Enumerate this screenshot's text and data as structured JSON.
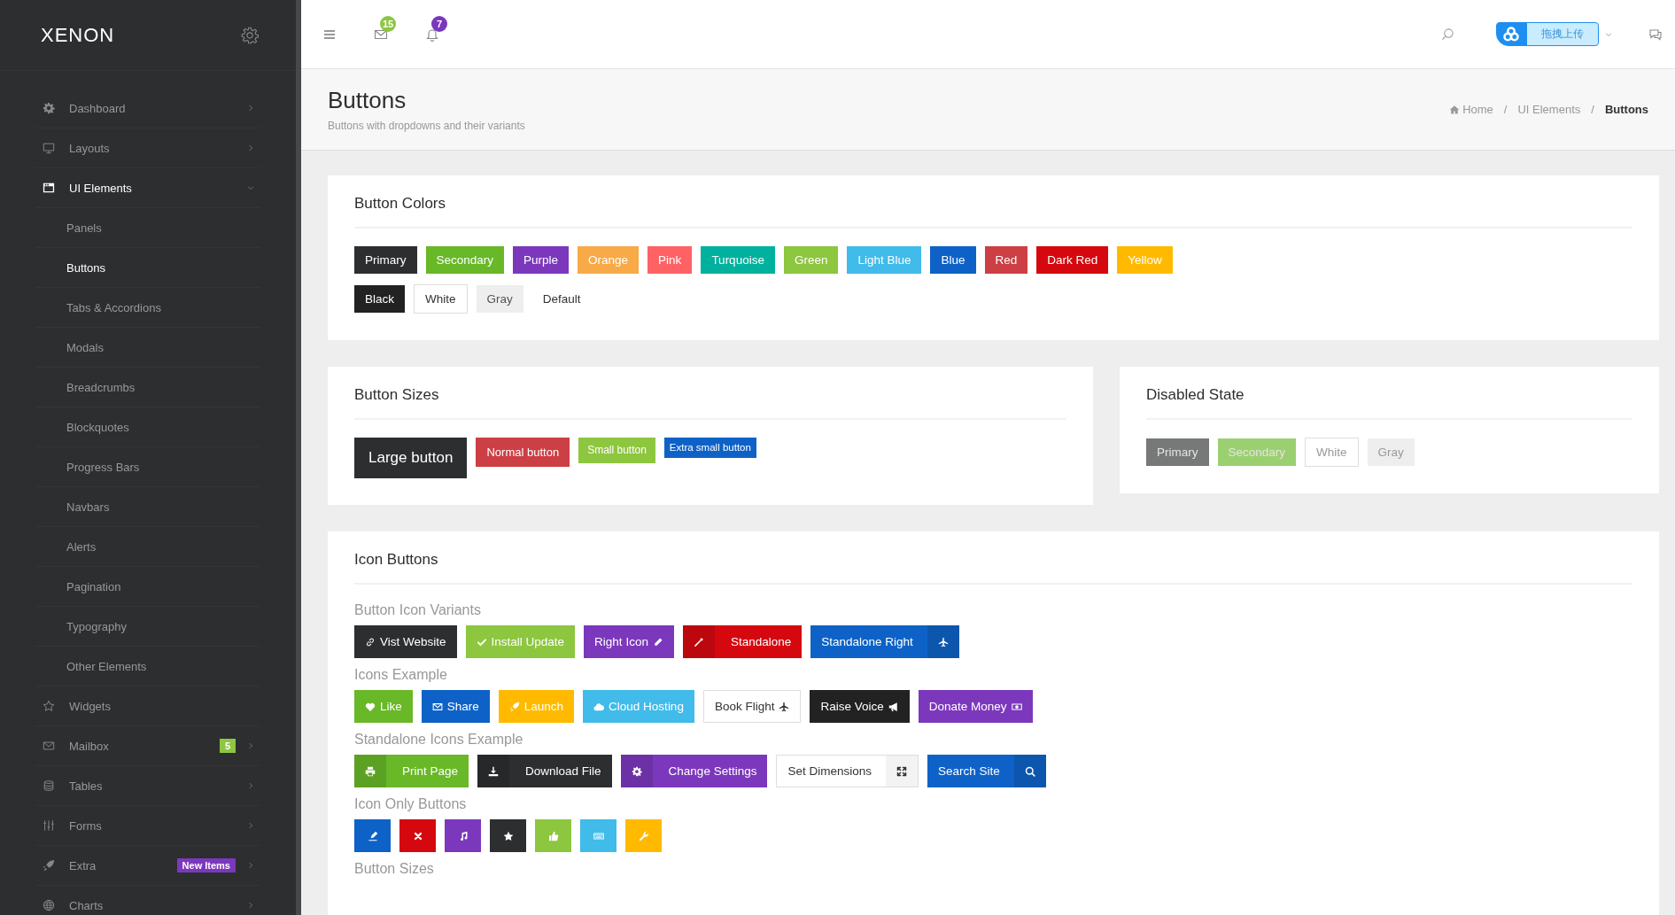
{
  "sidebar": {
    "logo": "XENON",
    "items": [
      {
        "label": "Dashboard",
        "expandable": true,
        "expanded": false,
        "selected": false
      },
      {
        "label": "Layouts",
        "expandable": true,
        "expanded": false,
        "selected": false
      },
      {
        "label": "UI Elements",
        "expandable": true,
        "expanded": true,
        "selected": true,
        "children": [
          {
            "label": "Panels",
            "selected": false
          },
          {
            "label": "Buttons",
            "selected": true
          },
          {
            "label": "Tabs & Accordions",
            "selected": false
          },
          {
            "label": "Modals",
            "selected": false
          },
          {
            "label": "Breadcrumbs",
            "selected": false
          },
          {
            "label": "Blockquotes",
            "selected": false
          },
          {
            "label": "Progress Bars",
            "selected": false
          },
          {
            "label": "Navbars",
            "selected": false
          },
          {
            "label": "Alerts",
            "selected": false
          },
          {
            "label": "Pagination",
            "selected": false
          },
          {
            "label": "Typography",
            "selected": false
          },
          {
            "label": "Other Elements",
            "selected": false
          }
        ]
      },
      {
        "label": "Widgets",
        "expandable": false,
        "selected": false
      },
      {
        "label": "Mailbox",
        "expandable": true,
        "expanded": false,
        "selected": false,
        "badge": "5",
        "color": "#8dc63f"
      },
      {
        "label": "Tables",
        "expandable": true,
        "expanded": false,
        "selected": false
      },
      {
        "label": "Forms",
        "expandable": true,
        "expanded": false,
        "selected": false
      },
      {
        "label": "Extra",
        "expandable": true,
        "expanded": false,
        "selected": false,
        "badge": "New Items",
        "color": "#7c38bc"
      },
      {
        "label": "Charts",
        "expandable": true,
        "expanded": false,
        "selected": false
      }
    ]
  },
  "header": {
    "badges": [
      {
        "count": "15",
        "color": "#8dc63f"
      },
      {
        "count": "7",
        "color": "#7c38bc"
      }
    ],
    "upload_label": "拖拽上传"
  },
  "page_title": {
    "title": "Buttons",
    "subtitle": "Buttons with dropdowns and their variants",
    "separator": "/",
    "breadcrumb": [
      {
        "label": "Home",
        "active": false
      },
      {
        "label": "UI Elements",
        "active": false
      },
      {
        "label": "Buttons",
        "active": true
      }
    ]
  },
  "button_colors": {
    "title": "Button Colors",
    "rows": [
      [
        {
          "label": "Primary",
          "color": "#2c2e2f",
          "kind": "filled"
        },
        {
          "label": "Secondary",
          "color": "#68b828",
          "kind": "filled"
        },
        {
          "label": "Purple",
          "color": "#7c38bc",
          "kind": "filled"
        },
        {
          "label": "Orange",
          "color": "#f7aa47",
          "kind": "filled"
        },
        {
          "label": "Pink",
          "color": "#ff6264",
          "kind": "filled"
        },
        {
          "label": "Turquoise",
          "color": "#00b19d",
          "kind": "filled"
        },
        {
          "label": "Green",
          "color": "#8dc63f",
          "kind": "filled"
        },
        {
          "label": "Light Blue",
          "color": "#40bbea",
          "kind": "filled"
        },
        {
          "label": "Blue",
          "color": "#0e62c7",
          "kind": "filled"
        },
        {
          "label": "Red",
          "color": "#cc3f44",
          "kind": "filled"
        },
        {
          "label": "Dark Red",
          "color": "#d5080f",
          "kind": "filled"
        },
        {
          "label": "Yellow",
          "color": "#ffba00",
          "kind": "filled"
        }
      ],
      [
        {
          "label": "Black",
          "color": "#222222",
          "kind": "filled"
        },
        {
          "label": "White",
          "color": "#ffffff",
          "kind": "outlined"
        },
        {
          "label": "Gray",
          "color": "#eeeeee",
          "kind": "light"
        },
        {
          "label": "Default",
          "color": "#ffffff",
          "kind": "plain"
        }
      ]
    ]
  },
  "button_sizes": {
    "title": "Button Sizes",
    "buttons": [
      {
        "label": "Large button",
        "color": "#2c2e2f",
        "kind": "large"
      },
      {
        "label": "Normal button",
        "color": "#cc3f44",
        "kind": "normal"
      },
      {
        "label": "Small button",
        "color": "#8dc63f",
        "kind": "small"
      },
      {
        "label": "Extra small button",
        "color": "#0e62c7",
        "kind": "xsmall"
      }
    ]
  },
  "disabled_state": {
    "title": "Disabled State",
    "buttons": [
      {
        "label": "Primary",
        "color": "#777878",
        "kind": "filled",
        "disabled": true
      },
      {
        "label": "Secondary",
        "color": "#9bd070",
        "kind": "filled",
        "disabled": true
      },
      {
        "label": "White",
        "color": "#ffffff",
        "kind": "outlined",
        "disabled": true
      },
      {
        "label": "Gray",
        "color": "#eeeeee",
        "kind": "light",
        "disabled": true
      }
    ]
  },
  "icon_buttons": {
    "title": "Icon Buttons",
    "groups": [
      {
        "title": "Button Icon Variants",
        "buttons": [
          {
            "label": "Vist Website",
            "color": "#2c2e2f",
            "kind": "icon-left"
          },
          {
            "label": "Install Update",
            "color": "#8dc63f",
            "kind": "icon-left"
          },
          {
            "label": "Right Icon",
            "color": "#7c38bc",
            "kind": "icon-right"
          },
          {
            "label": "Standalone",
            "color": "#d5080f",
            "kind": "standalone-left"
          },
          {
            "label": "Standalone Right",
            "color": "#0e62c7",
            "kind": "standalone-right"
          }
        ]
      },
      {
        "title": "Icons Example",
        "buttons": [
          {
            "label": "Like",
            "color": "#68b828",
            "kind": "icon-left"
          },
          {
            "label": "Share",
            "color": "#0e62c7",
            "kind": "icon-left"
          },
          {
            "label": "Launch",
            "color": "#ffba00",
            "kind": "icon-left"
          },
          {
            "label": "Cloud Hosting",
            "color": "#40bbea",
            "kind": "icon-left"
          },
          {
            "label": "Book Flight",
            "color": "#ffffff",
            "kind": "icon-right"
          },
          {
            "label": "Raise Voice",
            "color": "#222222",
            "kind": "icon-right"
          },
          {
            "label": "Donate Money",
            "color": "#7c38bc",
            "kind": "icon-right"
          }
        ]
      },
      {
        "title": "Standalone Icons Example",
        "buttons": [
          {
            "label": "Print Page",
            "color": "#68b828",
            "kind": "standalone-left"
          },
          {
            "label": "Download File",
            "color": "#2c2e2f",
            "kind": "standalone-left"
          },
          {
            "label": "Change Settings",
            "color": "#7c38bc",
            "kind": "standalone-left"
          },
          {
            "label": "Set Dimensions",
            "color": "#ffffff",
            "kind": "standalone-right"
          },
          {
            "label": "Search Site",
            "color": "#0e62c7",
            "kind": "standalone-right"
          }
        ]
      },
      {
        "title": "Icon Only Buttons",
        "buttons": [
          {
            "color": "#0e62c7",
            "kind": "icon-only"
          },
          {
            "color": "#d5080f",
            "kind": "icon-only"
          },
          {
            "color": "#7c38bc",
            "kind": "icon-only"
          },
          {
            "color": "#2c2e2f",
            "kind": "icon-only"
          },
          {
            "color": "#8dc63f",
            "kind": "icon-only"
          },
          {
            "color": "#40bbea",
            "kind": "icon-only"
          },
          {
            "color": "#ffba00",
            "kind": "icon-only"
          }
        ]
      },
      {
        "title": "Button Sizes"
      }
    ]
  }
}
